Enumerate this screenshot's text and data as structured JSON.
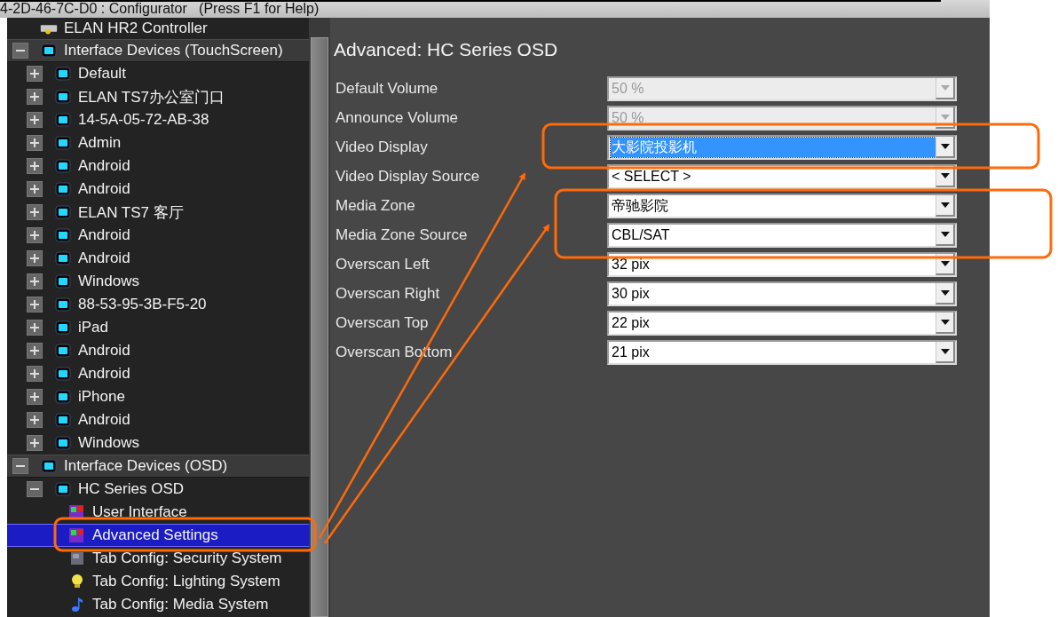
{
  "window": {
    "title": "4-2D-46-7C-D0 : Configurator   (Press F1 for Help)"
  },
  "tree": [
    {
      "label": "ELAN HR2 Controller",
      "kind": "controller",
      "selected": false
    },
    {
      "label": "Interface Devices (TouchScreen)",
      "kind": "screen",
      "expanded": true,
      "selected": false,
      "children": [
        {
          "label": "Default",
          "kind": "screen",
          "expanded": false,
          "selected": false
        },
        {
          "label": "ELAN TS7办公室门口",
          "kind": "screen",
          "expanded": false,
          "selected": false
        },
        {
          "label": "14-5A-05-72-AB-38",
          "kind": "screen",
          "expanded": false,
          "selected": false
        },
        {
          "label": "Admin",
          "kind": "screen",
          "expanded": false,
          "selected": false
        },
        {
          "label": "Android",
          "kind": "screen",
          "expanded": false,
          "selected": false
        },
        {
          "label": "Android",
          "kind": "screen",
          "expanded": false,
          "selected": false
        },
        {
          "label": "ELAN TS7 客厅",
          "kind": "screen",
          "expanded": false,
          "selected": false
        },
        {
          "label": "Android",
          "kind": "screen",
          "expanded": false,
          "selected": false
        },
        {
          "label": "Android",
          "kind": "screen",
          "expanded": false,
          "selected": false
        },
        {
          "label": "Windows",
          "kind": "screen",
          "expanded": false,
          "selected": false
        },
        {
          "label": "88-53-95-3B-F5-20",
          "kind": "screen",
          "expanded": false,
          "selected": false
        },
        {
          "label": "iPad",
          "kind": "screen",
          "expanded": false,
          "selected": false
        },
        {
          "label": "Android",
          "kind": "screen",
          "expanded": false,
          "selected": false
        },
        {
          "label": "Android",
          "kind": "screen",
          "expanded": false,
          "selected": false
        },
        {
          "label": "iPhone",
          "kind": "screen",
          "expanded": false,
          "selected": false
        },
        {
          "label": "Android",
          "kind": "screen",
          "expanded": false,
          "selected": false
        },
        {
          "label": "Windows",
          "kind": "screen",
          "expanded": false,
          "selected": false
        }
      ]
    },
    {
      "label": "Interface Devices (OSD)",
      "kind": "screen",
      "expanded": true,
      "selected": false,
      "children": [
        {
          "label": "HC Series OSD",
          "kind": "screen",
          "expanded": true,
          "selected": false,
          "children": [
            {
              "label": "User Interface",
              "kind": "palette",
              "selected": false
            },
            {
              "label": "Advanced Settings",
              "kind": "palette",
              "selected": true
            },
            {
              "label": "Tab Config: Security System",
              "kind": "security",
              "selected": false
            },
            {
              "label": "Tab Config: Lighting System",
              "kind": "bulb",
              "selected": false
            },
            {
              "label": "Tab Config: Media System",
              "kind": "music",
              "selected": false
            }
          ]
        }
      ]
    }
  ],
  "panel": {
    "title": "Advanced: HC Series OSD",
    "fields": [
      {
        "label": "Default Volume",
        "value": "50 %",
        "disabled": true,
        "highlighted": false
      },
      {
        "label": "Announce Volume",
        "value": "50 %",
        "disabled": true,
        "highlighted": false
      },
      {
        "label": "Video Display",
        "value": "大影院投影机",
        "disabled": false,
        "highlighted": true
      },
      {
        "label": "Video Display Source",
        "value": "< SELECT >",
        "disabled": false,
        "highlighted": false
      },
      {
        "label": "Media Zone",
        "value": "帝驰影院",
        "disabled": false,
        "highlighted": false
      },
      {
        "label": "Media Zone Source",
        "value": "CBL/SAT",
        "disabled": false,
        "highlighted": false
      },
      {
        "label": "Overscan Left",
        "value": "32 pix",
        "disabled": false,
        "highlighted": false
      },
      {
        "label": "Overscan Right",
        "value": "30 pix",
        "disabled": false,
        "highlighted": false
      },
      {
        "label": "Overscan Top",
        "value": "22 pix",
        "disabled": false,
        "highlighted": false
      },
      {
        "label": "Overscan Bottom",
        "value": "21 pix",
        "disabled": false,
        "highlighted": false
      }
    ]
  }
}
